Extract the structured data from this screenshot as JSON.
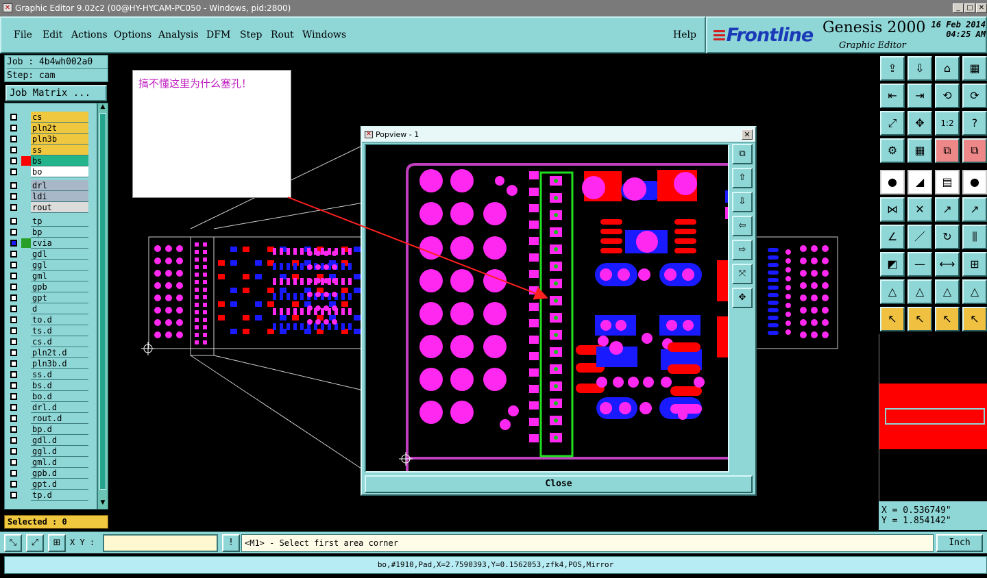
{
  "window": {
    "title": "Graphic Editor 9.02c2 (00@HY-HYCAM-PC050 - Windows, pid:2800)",
    "icon": "app-icon",
    "controls": [
      "_",
      "□",
      "✕"
    ]
  },
  "menu": {
    "items": [
      "File",
      "Edit",
      "Actions",
      "Options",
      "Analysis",
      "DFM",
      "Step",
      "Rout",
      "Windows"
    ],
    "help": "Help"
  },
  "brand": {
    "logo": "Frontline",
    "product": "Genesis 2000",
    "subtitle": "Graphic Editor",
    "date": "16 Feb 2014",
    "time": "04:25 AM"
  },
  "job": {
    "job_label": "Job : 4b4wh002a0",
    "step_label": "Step: cam",
    "matrix_button": "Job Matrix ..."
  },
  "layers": [
    {
      "name": "cs",
      "color": "#f0c840",
      "swatch": ""
    },
    {
      "name": "pln2t",
      "color": "#f0c840",
      "swatch": ""
    },
    {
      "name": "pln3b",
      "color": "#f0c840",
      "swatch": ""
    },
    {
      "name": "ss",
      "color": "#f0c840",
      "swatch": ""
    },
    {
      "name": "bs",
      "color": "#24b48c",
      "swatch": "#ff0000"
    },
    {
      "name": "bo",
      "color": "#ffffff",
      "swatch": ""
    },
    {
      "name": "drl",
      "color": "#a8b8c8",
      "swatch": ""
    },
    {
      "name": "ldi",
      "color": "#a8b8c8",
      "swatch": ""
    },
    {
      "name": "rout",
      "color": "#dcdcdc",
      "swatch": ""
    },
    {
      "name": "tp",
      "color": "#8fd6d6",
      "swatch": ""
    },
    {
      "name": "bp",
      "color": "#8fd6d6",
      "swatch": ""
    },
    {
      "name": "cvia",
      "color": "#8fd6d6",
      "swatch": "#28a028"
    },
    {
      "name": "gdl",
      "color": "#8fd6d6",
      "swatch": ""
    },
    {
      "name": "ggl",
      "color": "#8fd6d6",
      "swatch": ""
    },
    {
      "name": "gml",
      "color": "#8fd6d6",
      "swatch": ""
    },
    {
      "name": "gpb",
      "color": "#8fd6d6",
      "swatch": ""
    },
    {
      "name": "gpt",
      "color": "#8fd6d6",
      "swatch": ""
    },
    {
      "name": "d",
      "color": "#8fd6d6",
      "swatch": ""
    },
    {
      "name": "to.d",
      "color": "#8fd6d6",
      "swatch": ""
    },
    {
      "name": "ts.d",
      "color": "#8fd6d6",
      "swatch": ""
    },
    {
      "name": "cs.d",
      "color": "#8fd6d6",
      "swatch": ""
    },
    {
      "name": "pln2t.d",
      "color": "#8fd6d6",
      "swatch": ""
    },
    {
      "name": "pln3b.d",
      "color": "#8fd6d6",
      "swatch": ""
    },
    {
      "name": "ss.d",
      "color": "#8fd6d6",
      "swatch": ""
    },
    {
      "name": "bs.d",
      "color": "#8fd6d6",
      "swatch": ""
    },
    {
      "name": "bo.d",
      "color": "#8fd6d6",
      "swatch": ""
    },
    {
      "name": "drl.d",
      "color": "#8fd6d6",
      "swatch": ""
    },
    {
      "name": "rout.d",
      "color": "#8fd6d6",
      "swatch": ""
    },
    {
      "name": "bp.d",
      "color": "#8fd6d6",
      "swatch": ""
    },
    {
      "name": "gdl.d",
      "color": "#8fd6d6",
      "swatch": ""
    },
    {
      "name": "ggl.d",
      "color": "#8fd6d6",
      "swatch": ""
    },
    {
      "name": "gml.d",
      "color": "#8fd6d6",
      "swatch": ""
    },
    {
      "name": "gpb.d",
      "color": "#8fd6d6",
      "swatch": ""
    },
    {
      "name": "gpt.d",
      "color": "#8fd6d6",
      "swatch": ""
    },
    {
      "name": "tp.d",
      "color": "#8fd6d6",
      "swatch": ""
    }
  ],
  "selected": "Selected : 0",
  "annotation": "搞不懂这里为什么塞孔！",
  "popview": {
    "title": "Popview - 1",
    "close_label": "Close",
    "close_x": "✕"
  },
  "coords": {
    "x": "X = 0.536749\"",
    "y": "Y = 1.854142\""
  },
  "bottom": {
    "xy_label": "X Y :",
    "xy_value": "",
    "bang": "!",
    "prompt": "<M1> - Select first area corner",
    "units": "Inch"
  },
  "status": "bo,#1910,Pad,X=2.7590393,Y=0.1562053,zfk4,POS,Mirror",
  "colors": {
    "accent": "#8fd6d6",
    "pad": "#ff28f0",
    "copper": "#ff0000",
    "blue": "#1a1aff",
    "highlight": "#20e020"
  },
  "tools": [
    "home-icon",
    "save-icon",
    "window-icon",
    "grid-icon",
    "import-icon",
    "export-icon",
    "undo-icon",
    "redo-icon",
    "fit-icon",
    "center-icon",
    "scale-icon",
    "help-icon",
    "settings-icon",
    "grid-view-icon",
    "layers-icon",
    "layers-alt-icon",
    "point-icon",
    "line-icon",
    "ruler-icon",
    "circle-icon",
    "connect-icon",
    "cross-icon",
    "snap-icon",
    "snap-alt-icon",
    "angle-icon",
    "slash-icon",
    "rotate-icon",
    "split-icon",
    "pad-icon",
    "minus-icon",
    "measure-icon",
    "group-icon",
    "arrow-up-icon",
    "arrow-up2-icon",
    "arrow-up3-icon",
    "arrow-up4-icon",
    "pointer-icon",
    "pointer-box-icon",
    "pointer-alt-icon",
    "pointer-pan-icon"
  ]
}
